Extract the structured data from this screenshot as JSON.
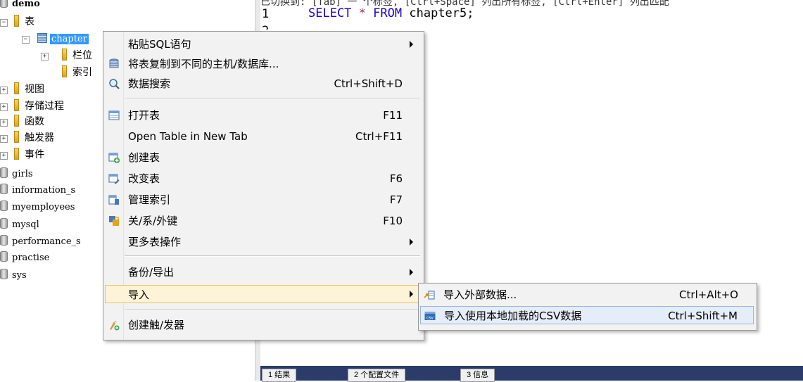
{
  "tree": {
    "root_db": "demo",
    "tables_folder": "表",
    "selected_table": "chapter",
    "columns_folder": "栏位",
    "indexes_folder": "索引",
    "folders": [
      "视图",
      "存储过程",
      "函数",
      "触发器",
      "事件"
    ],
    "databases": [
      "girls",
      "information_s",
      "myemployees",
      "mysql",
      "performance_s",
      "practise",
      "sys"
    ],
    "toggle_expanded": "−",
    "toggle_collapsed": "+"
  },
  "editor": {
    "header_text": "已切换到: [Tab] 一 个标签, [Ctrl+Space] 列出所有标签, [Ctrl+Enter] 列出匹配",
    "line1_no": "1",
    "line2_no": "2",
    "sql": {
      "kw1": "SELECT",
      "star": "*",
      "kw2": "FROM",
      "table": "chapter5;"
    },
    "colors": {
      "keyword": "#1c00cf",
      "star": "#8b3a62",
      "text": "#000000"
    }
  },
  "bottom_tabs": [
    "1 结果",
    "2 个配置文件",
    "3 信息"
  ],
  "context_menu": {
    "items": [
      {
        "label": "粘贴SQL语句",
        "shortcut": "",
        "submenu": true,
        "icon": ""
      },
      {
        "label": "将表复制到不同的主机/数据库...",
        "shortcut": "",
        "submenu": false,
        "icon": "copy-db-icon"
      },
      {
        "label": "数据搜索",
        "shortcut": "Ctrl+Shift+D",
        "submenu": false,
        "icon": "search-icon"
      },
      {
        "label": "打开表",
        "shortcut": "F11",
        "submenu": false,
        "icon": "table-icon"
      },
      {
        "label": "Open Table in New Tab",
        "shortcut": "Ctrl+F11",
        "submenu": false,
        "icon": ""
      },
      {
        "label": "创建表",
        "shortcut": "",
        "submenu": false,
        "icon": "create-table-icon"
      },
      {
        "label": "改变表",
        "shortcut": "F6",
        "submenu": false,
        "icon": "alter-table-icon"
      },
      {
        "label": "管理索引",
        "shortcut": "F7",
        "submenu": false,
        "icon": "index-icon"
      },
      {
        "label": "关/系/外键",
        "shortcut": "F10",
        "submenu": false,
        "icon": "relation-icon"
      },
      {
        "label": "更多表操作",
        "shortcut": "",
        "submenu": true,
        "icon": ""
      },
      {
        "label": "备份/导出",
        "shortcut": "",
        "submenu": true,
        "icon": ""
      },
      {
        "label": "导入",
        "shortcut": "",
        "submenu": true,
        "icon": ""
      },
      {
        "label": "创建触/发器",
        "shortcut": "",
        "submenu": false,
        "icon": "trigger-icon"
      }
    ]
  },
  "import_submenu": {
    "items": [
      {
        "label": "导入外部数据...",
        "shortcut": "Ctrl+Alt+O",
        "icon": "import-external-icon"
      },
      {
        "label": "导入使用本地加载的CSV数据",
        "shortcut": "Ctrl+Shift+M",
        "icon": "csv-icon"
      }
    ]
  }
}
